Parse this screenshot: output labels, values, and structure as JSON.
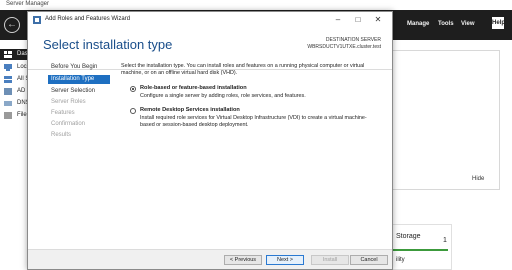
{
  "server_manager": {
    "title": "Server Manager",
    "menu": {
      "manage": "Manage",
      "tools": "Tools",
      "view": "View",
      "help": "Help"
    },
    "sidebar": [
      {
        "label": "Dash",
        "active": true
      },
      {
        "label": "Local",
        "active": false
      },
      {
        "label": "All S",
        "active": false
      },
      {
        "label": "AD D",
        "active": false
      },
      {
        "label": "DNS",
        "active": false
      },
      {
        "label": "File a",
        "active": false
      }
    ],
    "hide_label": "Hide",
    "tile": {
      "title": "Storage",
      "count": "1",
      "sub": "ility"
    }
  },
  "wizard": {
    "title": "Add Roles and Features Wizard",
    "heading": "Select installation type",
    "destination_label": "DESTINATION SERVER",
    "destination_name": "WBRSDUCTV1UTXE.cluster.test",
    "steps": [
      {
        "label": "Before You Begin",
        "state": "normal"
      },
      {
        "label": "Installation Type",
        "state": "active"
      },
      {
        "label": "Server Selection",
        "state": "normal"
      },
      {
        "label": "Server Roles",
        "state": "disabled"
      },
      {
        "label": "Features",
        "state": "disabled"
      },
      {
        "label": "Confirmation",
        "state": "disabled"
      },
      {
        "label": "Results",
        "state": "disabled"
      }
    ],
    "intro": "Select the installation type. You can install roles and features on a running physical computer or virtual machine, or on an offline virtual hard disk (VHD).",
    "options": [
      {
        "title": "Role-based or feature-based installation",
        "description": "Configure a single server by adding roles, role services, and features.",
        "checked": true
      },
      {
        "title": "Remote Desktop Services installation",
        "description": "Install required role services for Virtual Desktop Infrastructure (VDI) to create a virtual machine-based or session-based desktop deployment.",
        "checked": false
      }
    ],
    "buttons": {
      "previous": "< Previous",
      "next": "Next >",
      "install": "Install",
      "cancel": "Cancel"
    }
  }
}
